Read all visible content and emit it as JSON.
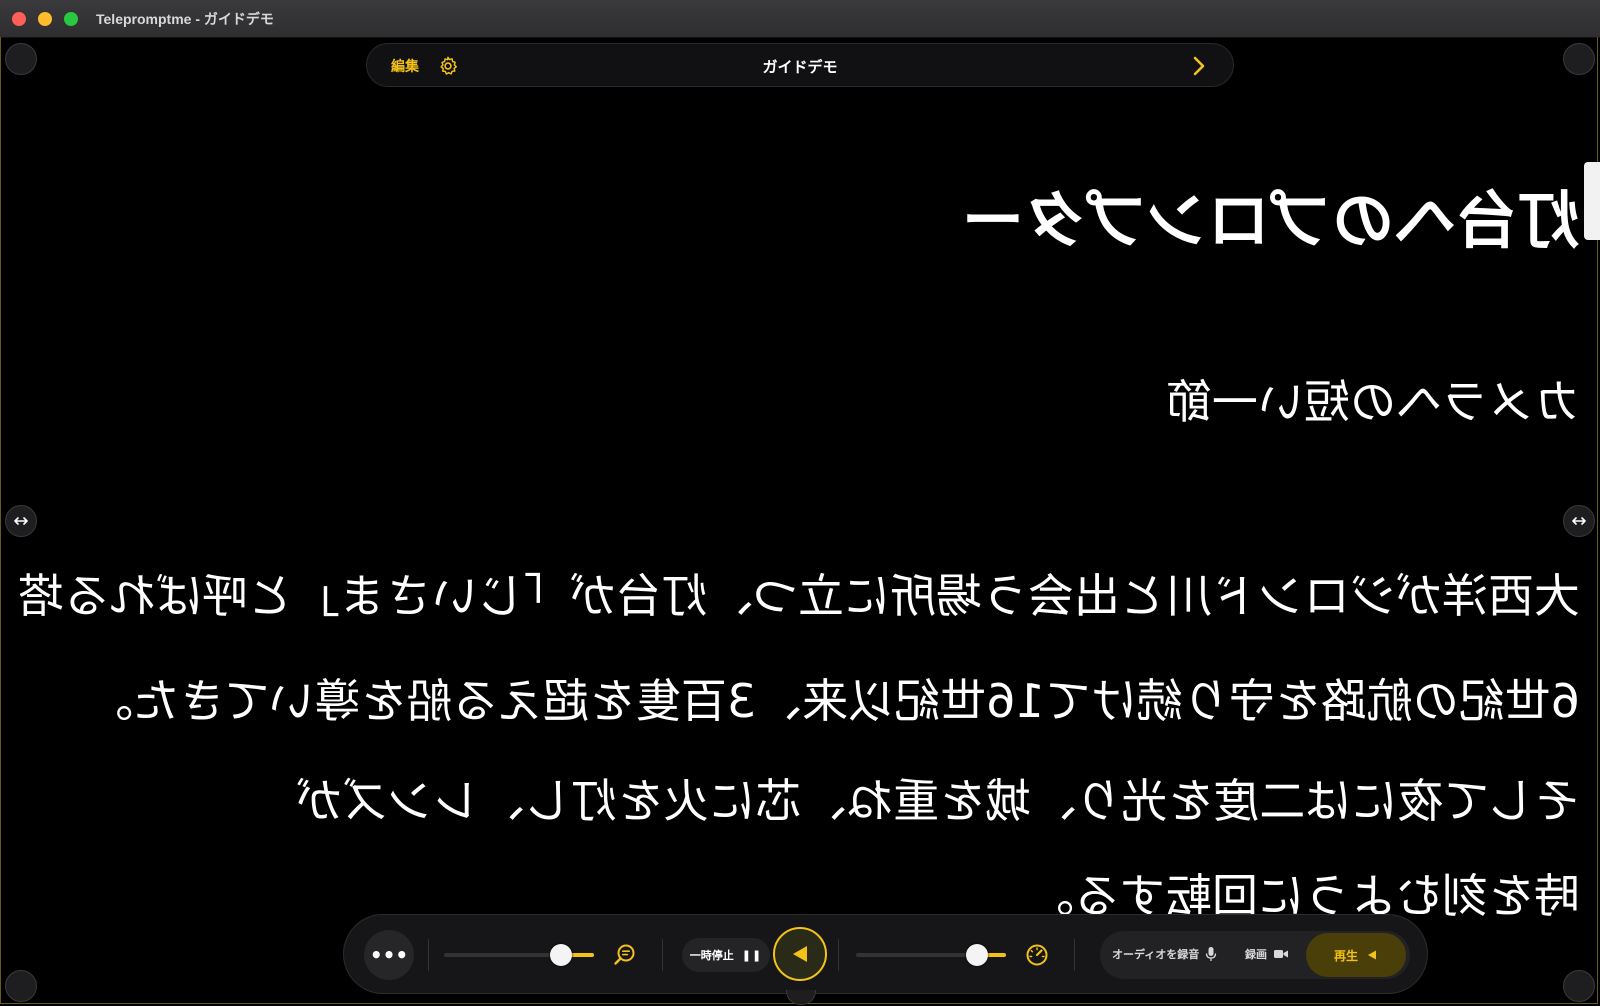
{
  "window": {
    "title": "Telepromptme - ガイドデモ"
  },
  "topbar": {
    "edit_label": "編集",
    "doc_title": "ガイドデモ"
  },
  "script": {
    "lines": [
      "灯台へのプロンプター",
      "カメラへの短い一節",
      "大西洋がジロンド川と出会う場所に立つ、灯台が「じいさま」と呼ばれる塔。",
      "6世紀の航路を守り続けて16世紀以来、3百隻を超える船を導いてきた。",
      "そして夜には二度を光り、城を重ね、芯に火を灯し、レンズが",
      "時を刻むように回転する。"
    ]
  },
  "controls": {
    "more_label": "•••",
    "pause_label": "一時停止",
    "pause_icon": "❚❚",
    "audio_label": "オーディオを録音",
    "record_label": "録画",
    "play_label": "再生"
  },
  "theme": {
    "accent": "#f2c21a",
    "background": "#000000",
    "text": "#ffffff"
  },
  "icons": {
    "zoom": "zoom-text-icon",
    "speed": "speedometer-icon",
    "gear": "gear-icon",
    "mic": "microphone-icon",
    "camera": "video-camera-icon"
  }
}
